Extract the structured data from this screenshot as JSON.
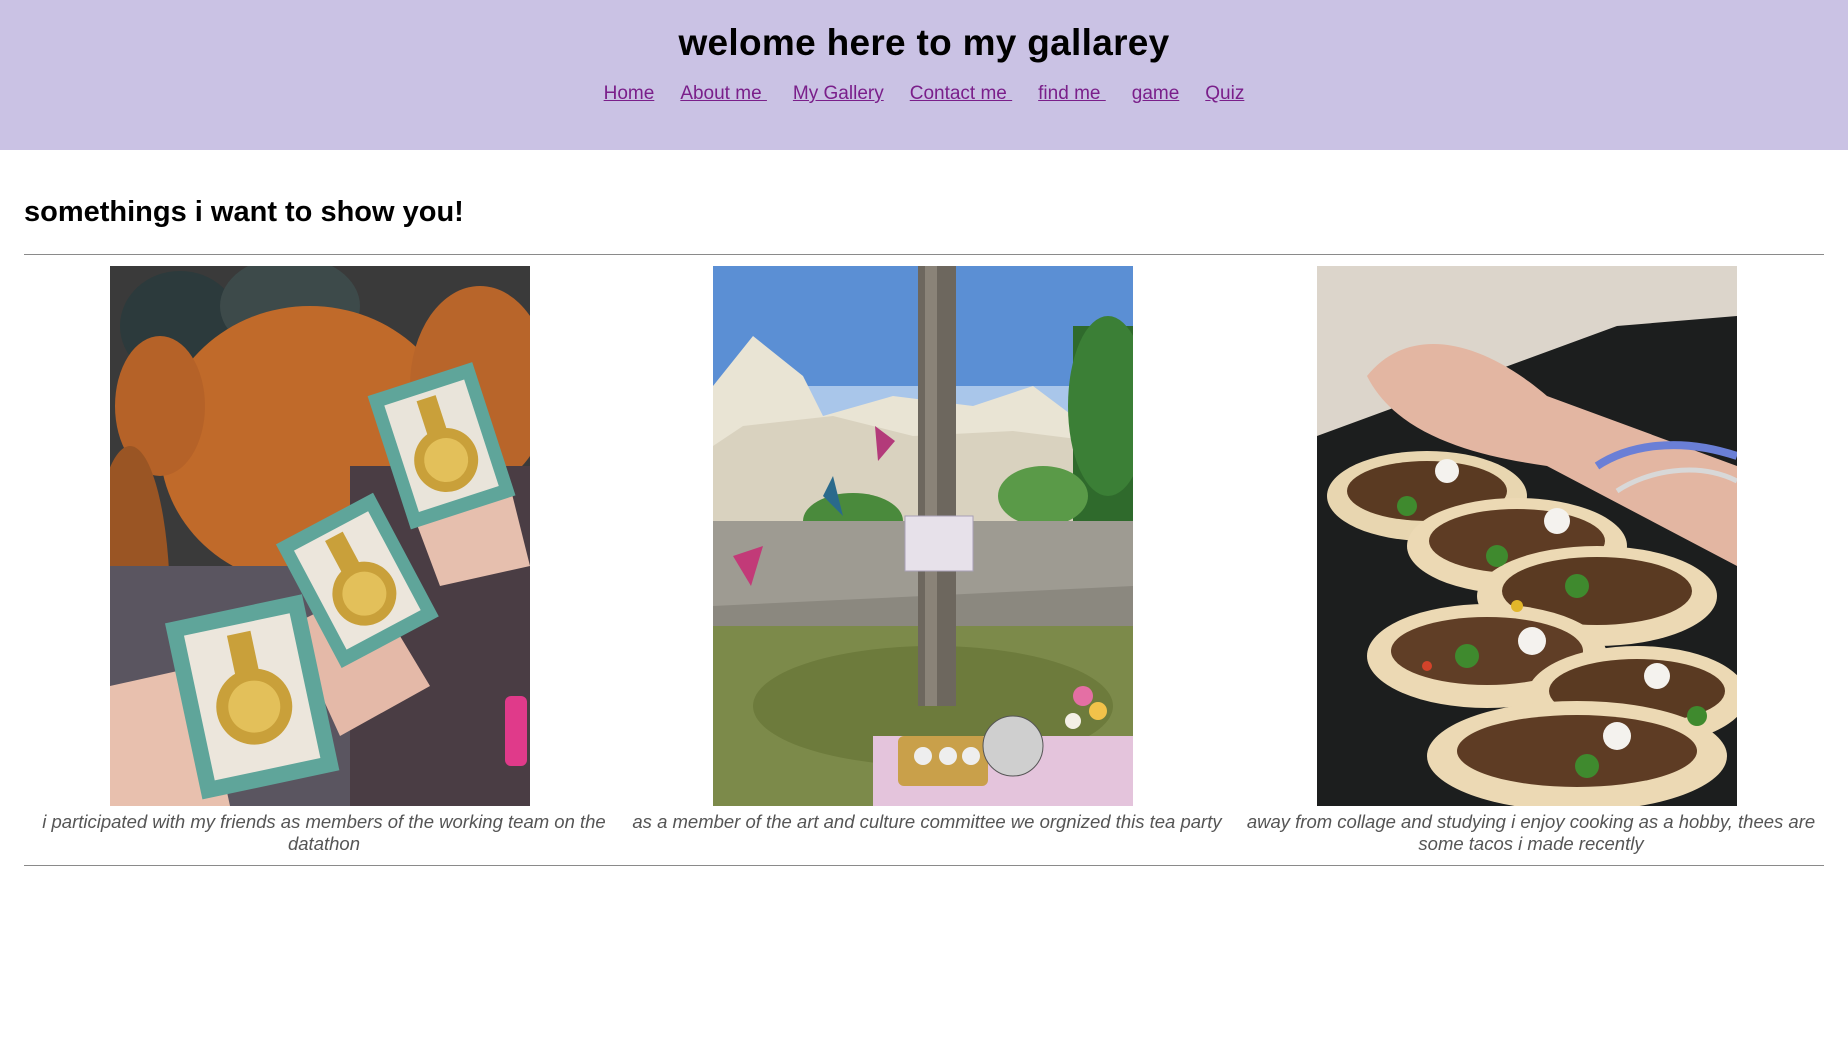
{
  "header": {
    "title": "welome here to my gallarey",
    "nav": [
      {
        "label": "Home"
      },
      {
        "label": "About me "
      },
      {
        "label": "My Gallery"
      },
      {
        "label": "Contact me "
      },
      {
        "label": "find me "
      },
      {
        "label": "game"
      },
      {
        "label": "Quiz"
      }
    ]
  },
  "main": {
    "heading": "somethings i want to show you!",
    "gallery": [
      {
        "image": "medals-photo",
        "caption": "i participated with my friends as members of the working team on the datathon"
      },
      {
        "image": "tea-party-photo",
        "caption": "as a member of the art and culture committee we orgnized this tea party"
      },
      {
        "image": "tacos-photo",
        "caption": "away from collage and studying i enjoy cooking as a hobby, thees are some tacos i made recently"
      }
    ]
  },
  "colors": {
    "header_bg": "#cac2e4",
    "link": "#7a1f8a",
    "caption": "#555555"
  }
}
